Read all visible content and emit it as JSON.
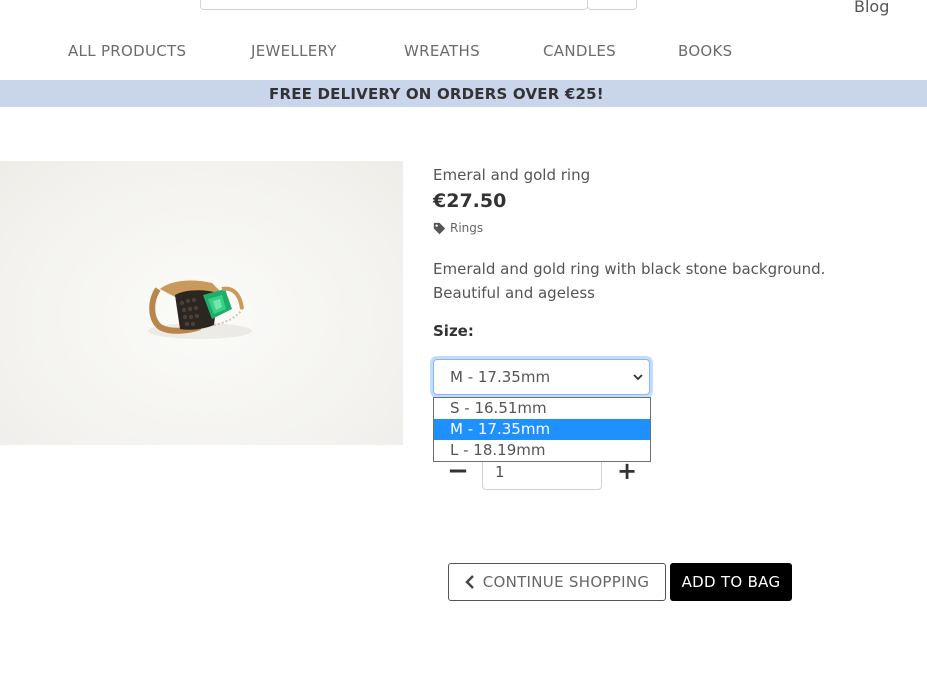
{
  "header": {
    "blog_link": "Blog"
  },
  "nav": {
    "items": [
      {
        "label": "ALL PRODUCTS"
      },
      {
        "label": "JEWELLERY"
      },
      {
        "label": "WREATHS"
      },
      {
        "label": "CANDLES"
      },
      {
        "label": "BOOKS"
      }
    ]
  },
  "banner": {
    "text": "FREE DELIVERY ON ORDERS OVER €25!"
  },
  "product": {
    "name": "Emeral and gold ring",
    "price": "€27.50",
    "category": "Rings",
    "description": "Emerald and gold ring with black stone background. Beautiful and ageless"
  },
  "size": {
    "label": "Size:",
    "selected": "M - 17.35mm",
    "options": [
      {
        "label": "S - 16.51mm"
      },
      {
        "label": "M - 17.35mm"
      },
      {
        "label": "L - 18.19mm"
      }
    ]
  },
  "quantity": {
    "value": "1",
    "minus_symbol": "−",
    "plus_symbol": "+"
  },
  "buttons": {
    "continue_shopping": "CONTINUE SHOPPING",
    "add_to_bag": "ADD TO BAG"
  },
  "colors": {
    "banner_bg": "#c8d5ea",
    "selected_option_bg": "#1e90ff",
    "add_button_bg": "#000000"
  }
}
